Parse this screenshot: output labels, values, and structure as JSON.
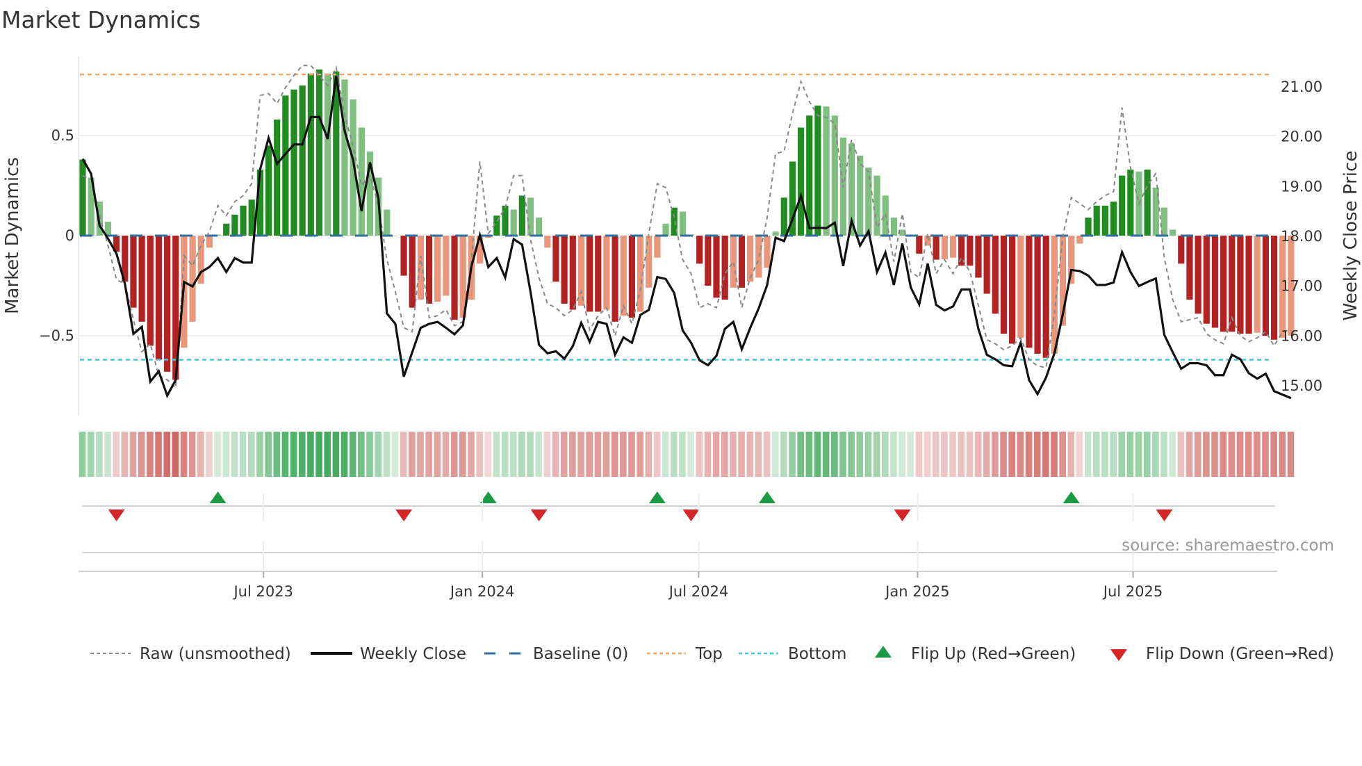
{
  "title": "Market Dynamics",
  "source": "source: sharemaestro.com",
  "colors": {
    "up_strong": "#228b22",
    "up_weak": "#7fbf7f",
    "down_strong": "#b22222",
    "down_weak": "#e9967a",
    "close": "#111111",
    "raw": "#888888",
    "baseline": "#2f6fa0",
    "top": "#f0a868",
    "bottom": "#3fc8d8",
    "flip_up": "#1a9a44",
    "flip_down": "#d62728",
    "heat_up": "#3aa655",
    "heat_down": "#c9504b"
  },
  "legend": {
    "raw": "Raw (unsmoothed)",
    "close": "Weekly Close",
    "baseline": "Baseline (0)",
    "top": "Top",
    "bottom": "Bottom",
    "flip_up": "Flip Up (Red→Green)",
    "flip_down": "Flip Down (Green→Red)"
  },
  "chart_data": {
    "type": "bar",
    "title": "Market Dynamics",
    "ylabel": "Market Dynamics",
    "y2label": "Weekly Close Price",
    "xunit": "week index",
    "ylim": [
      -0.92,
      0.92
    ],
    "y2lim": [
      14.5,
      21.5
    ],
    "yticks": [
      {
        "v": 0.5,
        "label": "0.5"
      },
      {
        "v": 0,
        "label": "0"
      },
      {
        "v": -0.5,
        "label": "−0.5"
      }
    ],
    "y2ticks": [
      {
        "v": 21,
        "label": "21.00"
      },
      {
        "v": 20,
        "label": "20.00"
      },
      {
        "v": 19,
        "label": "19.00"
      },
      {
        "v": 18,
        "label": "18.00"
      },
      {
        "v": 17,
        "label": "17.00"
      },
      {
        "v": 16,
        "label": "16.00"
      },
      {
        "v": 15,
        "label": "15.00"
      }
    ],
    "xticks": [
      {
        "week": 21.4,
        "label": "Jul 2023"
      },
      {
        "week": 47.3,
        "label": "Jan 2024"
      },
      {
        "week": 72.9,
        "label": "Jul 2024"
      },
      {
        "week": 98.8,
        "label": "Jan 2025"
      },
      {
        "week": 124.3,
        "label": "Jul 2025"
      }
    ],
    "top_level": 0.805,
    "bottom_level": -0.62,
    "baseline": 0,
    "momentum": [
      0.38,
      0.29,
      0.17,
      0.07,
      -0.08,
      -0.23,
      -0.36,
      -0.43,
      -0.55,
      -0.62,
      -0.68,
      -0.72,
      -0.56,
      -0.43,
      -0.24,
      -0.06,
      0.005,
      0.06,
      0.105,
      0.15,
      0.18,
      0.33,
      0.45,
      0.58,
      0.7,
      0.73,
      0.75,
      0.81,
      0.83,
      0.81,
      0.82,
      0.78,
      0.68,
      0.54,
      0.42,
      0.29,
      0.13,
      0.0,
      -0.2,
      -0.36,
      -0.32,
      -0.34,
      -0.33,
      -0.3,
      -0.42,
      -0.41,
      -0.32,
      -0.14,
      -0.01,
      0.1,
      0.15,
      0.13,
      0.2,
      0.19,
      0.09,
      -0.06,
      -0.23,
      -0.34,
      -0.37,
      -0.35,
      -0.38,
      -0.38,
      -0.37,
      -0.43,
      -0.4,
      -0.41,
      -0.38,
      -0.26,
      -0.11,
      0.06,
      0.14,
      0.12,
      0.005,
      -0.14,
      -0.25,
      -0.31,
      -0.32,
      -0.26,
      -0.26,
      -0.23,
      -0.21,
      -0.16,
      0.02,
      0.19,
      0.37,
      0.54,
      0.6,
      0.65,
      0.645,
      0.6,
      0.49,
      0.46,
      0.4,
      0.34,
      0.3,
      0.2,
      0.09,
      0.03,
      0.002,
      -0.09,
      -0.05,
      -0.12,
      -0.118,
      -0.11,
      -0.15,
      -0.15,
      -0.21,
      -0.29,
      -0.39,
      -0.49,
      -0.54,
      -0.51,
      -0.56,
      -0.59,
      -0.61,
      -0.59,
      -0.45,
      -0.24,
      -0.04,
      0.09,
      0.15,
      0.15,
      0.17,
      0.3,
      0.33,
      0.32,
      0.33,
      0.24,
      0.14,
      0.03,
      -0.14,
      -0.32,
      -0.39,
      -0.44,
      -0.46,
      -0.48,
      -0.48,
      -0.49,
      -0.49,
      -0.485,
      -0.5,
      -0.52,
      -0.51,
      -0.5
    ],
    "raw": [
      0.3,
      0.28,
      0.1,
      -0.05,
      -0.22,
      -0.24,
      -0.42,
      -0.58,
      -0.54,
      -0.7,
      -0.72,
      -0.76,
      -0.1,
      -0.15,
      -0.05,
      0.02,
      0.15,
      0.1,
      0.17,
      0.2,
      0.26,
      0.7,
      0.71,
      0.66,
      0.74,
      0.8,
      0.85,
      0.85,
      0.8,
      0.75,
      0.84,
      0.6,
      0.45,
      0.25,
      0.3,
      0.15,
      -0.12,
      -0.28,
      -0.46,
      -0.48,
      -0.1,
      -0.41,
      -0.4,
      -0.37,
      -0.45,
      -0.43,
      -0.12,
      0.37,
      0.01,
      0.07,
      0.14,
      0.3,
      0.3,
      -0.02,
      -0.21,
      -0.34,
      -0.36,
      -0.4,
      -0.37,
      -0.28,
      -0.47,
      -0.4,
      -0.36,
      -0.5,
      -0.35,
      -0.44,
      -0.27,
      0.01,
      0.26,
      0.24,
      0.09,
      -0.12,
      -0.19,
      -0.36,
      -0.34,
      -0.36,
      -0.19,
      -0.13,
      -0.36,
      -0.21,
      -0.12,
      0.09,
      0.41,
      0.42,
      0.61,
      0.77,
      0.67,
      0.6,
      0.59,
      0.56,
      0.24,
      0.48,
      0.36,
      0.32,
      0.04,
      0.11,
      -0.13,
      0.11,
      -0.18,
      -0.21,
      0.01,
      -0.19,
      -0.12,
      -0.19,
      -0.11,
      -0.18,
      -0.35,
      -0.52,
      -0.54,
      -0.57,
      -0.55,
      -0.51,
      -0.62,
      -0.65,
      -0.66,
      -0.39,
      0.0,
      0.19,
      0.16,
      0.13,
      0.17,
      0.2,
      0.22,
      0.64,
      0.34,
      0.16,
      0.25,
      0.31,
      -0.11,
      -0.32,
      -0.43,
      -0.42,
      -0.41,
      -0.49,
      -0.52,
      -0.54,
      -0.41,
      -0.5,
      -0.53,
      -0.51,
      -0.48,
      -0.55,
      -0.48,
      -0.47
    ],
    "close": [
      19.54,
      19.24,
      18.2,
      17.94,
      17.64,
      17.03,
      16.03,
      16.17,
      15.07,
      15.28,
      14.79,
      15.1,
      17.07,
      16.98,
      17.27,
      17.37,
      17.55,
      17.27,
      17.55,
      17.46,
      17.46,
      19.33,
      19.96,
      19.44,
      19.64,
      19.83,
      19.83,
      20.38,
      20.38,
      19.94,
      21.2,
      20.1,
      19.52,
      18.49,
      19.47,
      18.75,
      16.44,
      16.23,
      15.17,
      15.66,
      16.15,
      16.23,
      16.27,
      16.15,
      16.02,
      16.2,
      17.38,
      18.01,
      17.37,
      17.55,
      17.16,
      17.93,
      17.82,
      16.87,
      15.81,
      15.64,
      15.68,
      15.53,
      15.78,
      16.25,
      15.87,
      16.27,
      16.23,
      15.61,
      15.96,
      15.85,
      16.41,
      16.51,
      17.17,
      17.13,
      16.85,
      16.1,
      15.85,
      15.5,
      15.4,
      15.59,
      16.13,
      16.27,
      15.72,
      16.15,
      16.54,
      17.01,
      17.96,
      17.89,
      18.33,
      18.8,
      18.15,
      18.16,
      18.15,
      18.26,
      17.39,
      18.3,
      17.8,
      18.09,
      17.27,
      17.66,
      17.01,
      17.84,
      16.96,
      16.62,
      17.44,
      16.61,
      16.5,
      16.58,
      16.92,
      16.92,
      16.13,
      15.61,
      15.52,
      15.4,
      15.38,
      15.85,
      15.1,
      14.82,
      15.15,
      15.64,
      16.43,
      17.31,
      17.29,
      17.2,
      17.01,
      17.01,
      17.06,
      17.67,
      17.27,
      16.99,
      17.07,
      17.14,
      16.01,
      15.66,
      15.33,
      15.44,
      15.44,
      15.4,
      15.2,
      15.2,
      15.61,
      15.52,
      15.24,
      15.13,
      15.23,
      14.88,
      14.81,
      14.74
    ],
    "flip_up_weeks": [
      16,
      48,
      68,
      81,
      117
    ],
    "flip_down_weeks": [
      4,
      38,
      54,
      72,
      97,
      128
    ]
  }
}
